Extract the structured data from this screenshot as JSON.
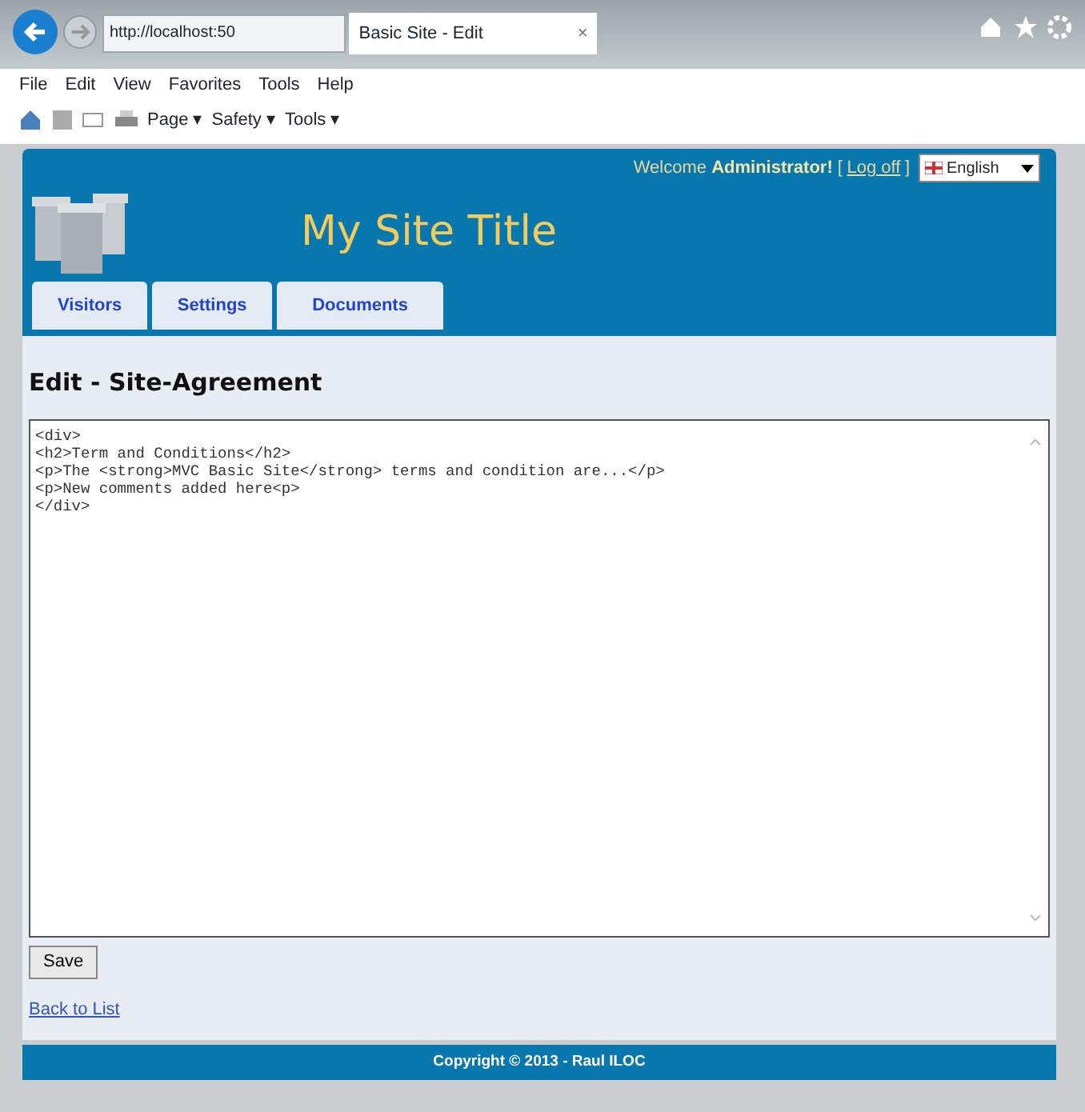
{
  "browser": {
    "address": "http://localhost:50",
    "tab_title": "Basic Site - Edit",
    "tab_close": "×",
    "menu": [
      "File",
      "Edit",
      "View",
      "Favorites",
      "Tools",
      "Help"
    ],
    "commands": [
      "Page ▾",
      "Safety ▾",
      "Tools ▾"
    ]
  },
  "header": {
    "welcome": "Welcome",
    "user": "Administrator!",
    "bracket_open": "[",
    "logoff": "Log off",
    "bracket_close": "]",
    "language": "English",
    "title": "My Site Title",
    "tabs": [
      {
        "label": "Visitors",
        "selected": false
      },
      {
        "label": "Settings",
        "selected": false
      },
      {
        "label": "Documents",
        "selected": false
      }
    ]
  },
  "page": {
    "heading": "Edit - Site-Agreement",
    "editor_lines": [
      "<div>",
      "<h2>Term and Conditions</h2>",
      "<p>The <strong>MVC Basic Site</strong> terms and condition are...</p>",
      "<p>New comments added here<p>",
      "</div>"
    ],
    "save": "Save",
    "back": "Back to List"
  },
  "footer": "Copyright © 2013 - Raul ILOC"
}
